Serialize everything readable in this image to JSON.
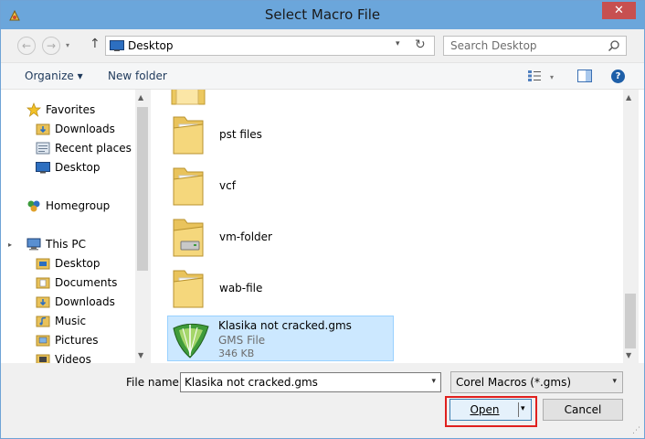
{
  "window": {
    "title": "Select Macro File",
    "close_glyph": "✕"
  },
  "nav": {
    "back_glyph": "←",
    "forward_glyph": "→",
    "up_glyph": "↑",
    "dropdown_glyph": "▾",
    "address": "Desktop",
    "refresh_glyph": "↻",
    "search_placeholder": "Search Desktop"
  },
  "toolbar": {
    "organize": "Organize ▾",
    "new_folder": "New folder",
    "help_glyph": "?"
  },
  "sidebar": {
    "favorites": "Favorites",
    "fav_items": [
      "Downloads",
      "Recent places",
      "Desktop"
    ],
    "homegroup": "Homegroup",
    "thispc": "This PC",
    "pc_items": [
      "Desktop",
      "Documents",
      "Downloads",
      "Music",
      "Pictures",
      "Videos"
    ],
    "chevron_glyph": "▸"
  },
  "files": {
    "folders": [
      "pst files",
      "vcf",
      "vm-folder",
      "wab-file"
    ],
    "selected": {
      "name": "Klasika not cracked.gms",
      "type": "GMS File",
      "size": "346 KB"
    }
  },
  "scroll": {
    "up_glyph": "▲",
    "down_glyph": "▼"
  },
  "bottom": {
    "file_name_label": "File name:",
    "file_name_value": "Klasika not cracked.gms",
    "filter_value": "Corel Macros (*.gms)",
    "open_label": "Open",
    "cancel_label": "Cancel",
    "dropdown_glyph": "▾",
    "grip_glyph": "⋰"
  },
  "colors": {
    "title_bar": "#6ba6db",
    "close": "#c75050",
    "selection": "#cce8ff",
    "highlight_border": "#e0201e"
  }
}
